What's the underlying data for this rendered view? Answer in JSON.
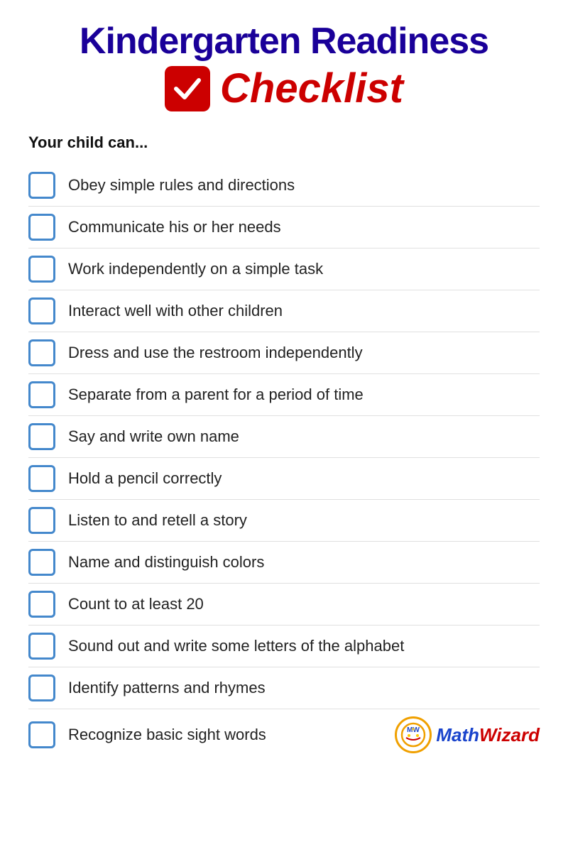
{
  "header": {
    "line1": "Kindergarten Readiness",
    "line2_checklist": "Checklist"
  },
  "subtitle": "Your child can...",
  "items": [
    {
      "id": 1,
      "text": "Obey simple rules and directions"
    },
    {
      "id": 2,
      "text": "Communicate his or her needs"
    },
    {
      "id": 3,
      "text": "Work independently on a simple task"
    },
    {
      "id": 4,
      "text": "Interact well with other children"
    },
    {
      "id": 5,
      "text": "Dress and use the restroom independently"
    },
    {
      "id": 6,
      "text": "Separate from a parent for a period of time"
    },
    {
      "id": 7,
      "text": "Say and write own name"
    },
    {
      "id": 8,
      "text": "Hold a pencil correctly"
    },
    {
      "id": 9,
      "text": "Listen to and retell a story"
    },
    {
      "id": 10,
      "text": "Name and distinguish colors"
    },
    {
      "id": 11,
      "text": "Count to at least 20"
    },
    {
      "id": 12,
      "text": "Sound out and write some letters of the alphabet"
    },
    {
      "id": 13,
      "text": "Identify patterns and rhymes"
    },
    {
      "id": 14,
      "text": "Recognize basic sight words"
    }
  ],
  "logo": {
    "symbol": "✦",
    "math": "Math",
    "wizard": "Wizard"
  }
}
